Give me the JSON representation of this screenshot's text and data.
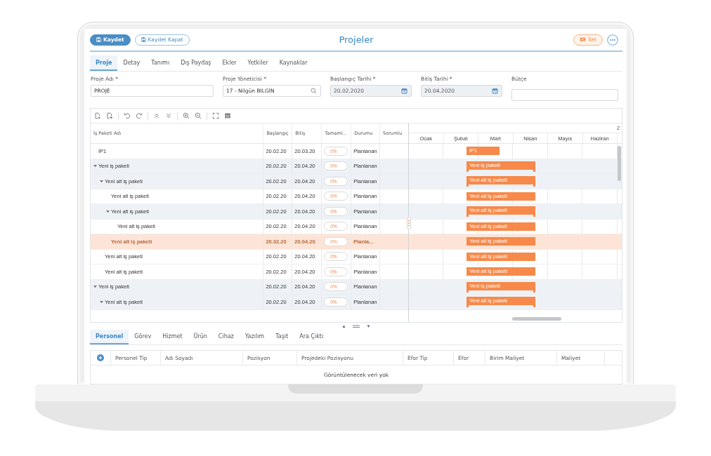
{
  "header": {
    "left_buttons": [
      {
        "label": "Kaydet",
        "kind": "primary"
      },
      {
        "label": "Kaydet Kapat",
        "kind": "outline"
      }
    ],
    "title": "Projeler",
    "right_buttons": [
      {
        "label": "İlet",
        "kind": "accent"
      }
    ]
  },
  "tabs": [
    {
      "label": "Proje",
      "selected": true
    },
    {
      "label": "Detay",
      "selected": false
    },
    {
      "label": "Tanımı",
      "selected": false
    },
    {
      "label": "Dış Paydaş",
      "selected": false
    },
    {
      "label": "Ekler",
      "selected": false
    },
    {
      "label": "Yetkiler",
      "selected": false
    },
    {
      "label": "Kaynaklar",
      "selected": false
    }
  ],
  "form": {
    "fields": [
      {
        "label": "Proje Adı *",
        "kind": "text",
        "value": "PROJE",
        "disabled": false
      },
      {
        "label": "Proje Yöneticisi *",
        "kind": "lookup",
        "value": "17 - Nilgün BILGİN",
        "disabled": false
      },
      {
        "label": "Başlangıç Tarihi *",
        "kind": "date",
        "value": "20.02.2020",
        "disabled": true
      },
      {
        "label": "Bitiş Tarihi *",
        "kind": "date",
        "value": "20.04.2020",
        "disabled": true
      },
      {
        "label": "Bütçe",
        "kind": "text",
        "disabled": false
      }
    ]
  },
  "work_packages": {
    "columns": [
      "İş Paketi Adı",
      "Başlangıç",
      "Bitiş",
      "Tamami...",
      "Durumu",
      "Sorumlu"
    ],
    "rows": [
      {
        "name": "İP1",
        "start": "20.02.20",
        "end": "20.03.20",
        "progress": "0%",
        "status": "Planlanan",
        "bar_label": "İP1",
        "selected": false
      },
      {
        "name": "Yeni iş paketi",
        "start": "20.02.20",
        "end": "20.04.20",
        "progress": "0%",
        "status": "Planlanan",
        "bar_label": "Yeni iş paketi",
        "selected": false,
        "expanded": true,
        "children": [
          {
            "name": "Yeni alt iş paketi",
            "start": "20.02.20",
            "end": "20.04.20",
            "progress": "0%",
            "status": "Planlanan",
            "bar_label": "Yeni alt iş paketi",
            "selected": false,
            "expanded": true,
            "children": [
              {
                "name": "Yeni alt iş paketi",
                "start": "20.02.20",
                "end": "20.04.20",
                "progress": "0%",
                "status": "Planlanan",
                "bar_label": "Yeni alt iş paketi",
                "selected": false
              },
              {
                "name": "Yeni alt iş paketi",
                "start": "20.02.20",
                "end": "20.04.20",
                "progress": "0%",
                "status": "Planlanan",
                "bar_label": "Yeni alt iş paketi",
                "selected": false,
                "expanded": true,
                "children": [
                  {
                    "name": "Yeni alt iş paketi",
                    "start": "20.02.20",
                    "end": "20.04.20",
                    "progress": "0%",
                    "status": "Planlanan",
                    "bar_label": "Yeni alt iş paketi",
                    "selected": false
                  }
                ]
              },
              {
                "name": "Yeni alt iş paketi",
                "start": "20.02.20",
                "end": "20.04.20",
                "progress": "0%",
                "status": "Planla...",
                "bar_label": "Yeni alt iş paketi",
                "selected": true
              }
            ]
          },
          {
            "name": "Yeni alt iş paketi",
            "start": "20.02.20",
            "end": "20.04.20",
            "progress": "0%",
            "status": "Planlanan",
            "bar_label": "Yeni alt iş paketi",
            "selected": false
          },
          {
            "name": "Yeni alt iş paketi",
            "start": "20.02.20",
            "end": "20.04.20",
            "progress": "0%",
            "status": "Planlanan",
            "bar_label": "Yeni alt iş paketi",
            "selected": false
          }
        ]
      },
      {
        "name": "Yeni iş paketi",
        "start": "20.02.20",
        "end": "20.04.20",
        "progress": "0%",
        "status": "Planlanan",
        "bar_label": "Yeni iş paketi",
        "selected": false,
        "expanded": true,
        "children": [
          {
            "name": "Yeni alt iş paketi",
            "start": "20.02.20",
            "end": "20.04.20",
            "progress": "0%",
            "status": "Planlanan",
            "bar_label": "Yeni alt iş paketi",
            "selected": false,
            "expanded": true
          }
        ]
      }
    ]
  },
  "gantt": {
    "year": "2",
    "months": [
      "Ocak",
      "Şubat",
      "Mart",
      "Nisan",
      "Mayıs",
      "Haziran"
    ]
  },
  "detail_tabs": [
    {
      "label": "Personel",
      "selected": true
    },
    {
      "label": "Görev",
      "selected": false
    },
    {
      "label": "Hizmet",
      "selected": false
    },
    {
      "label": "Ürün",
      "selected": false
    },
    {
      "label": "Cihaz",
      "selected": false
    },
    {
      "label": "Yazılım",
      "selected": false
    },
    {
      "label": "Taşıt",
      "selected": false
    },
    {
      "label": "Ara Çıktı",
      "selected": false
    }
  ],
  "detail_table": {
    "columns": [
      "Personel Tip",
      "Adı Soyadı",
      "Pozisyon",
      "Projedeki Pozisyonu",
      "Efor Tip",
      "Efor",
      "Birim Maliyet",
      "Maliyet"
    ],
    "empty_message": "Görüntülenecek veri yok"
  }
}
